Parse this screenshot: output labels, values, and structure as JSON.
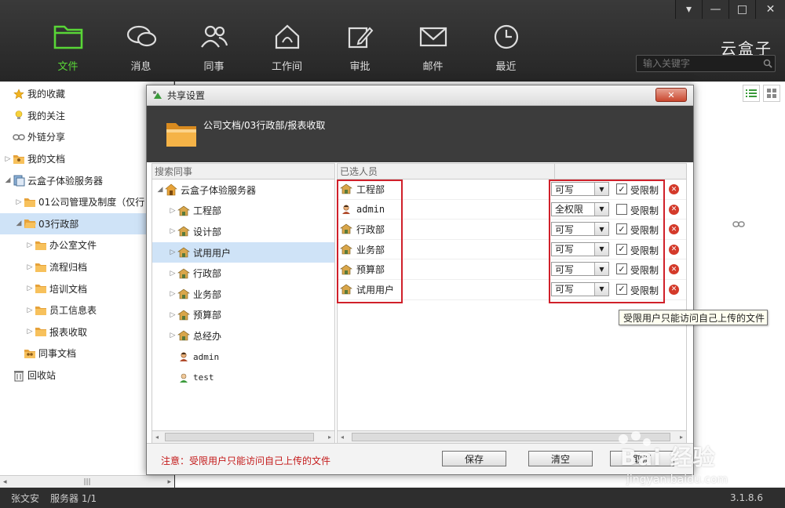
{
  "window": {
    "min": "▾",
    "restore": "—",
    "maximize": "□",
    "close": "✕"
  },
  "brand": "云盒子",
  "search": {
    "placeholder": "输入关键字"
  },
  "nav": [
    {
      "label": "文件",
      "icon": "folder-icon",
      "active": true
    },
    {
      "label": "消息",
      "icon": "chat-bubbles-icon"
    },
    {
      "label": "同事",
      "icon": "people-icon"
    },
    {
      "label": "工作间",
      "icon": "workspace-house-icon"
    },
    {
      "label": "审批",
      "icon": "edit-pen-icon"
    },
    {
      "label": "邮件",
      "icon": "mail-icon"
    },
    {
      "label": "最近",
      "icon": "clock-icon"
    }
  ],
  "left_tree": [
    {
      "label": "我的收藏",
      "icon": "star-icon",
      "indent": 1
    },
    {
      "label": "我的关注",
      "icon": "lightbulb-icon",
      "indent": 1
    },
    {
      "label": "外链分享",
      "icon": "link-icon",
      "indent": 1
    },
    {
      "label": "我的文档",
      "icon": "person-folder-icon",
      "indent": 1,
      "arrow": "▷"
    },
    {
      "label": "云盒子体验服务器",
      "icon": "server-icon",
      "indent": 1,
      "arrow": "◢"
    },
    {
      "label": "01公司管理及制度（仅行",
      "icon": "folder-icon",
      "indent": 2,
      "arrow": "▷"
    },
    {
      "label": "03行政部",
      "icon": "folder-open-icon",
      "indent": 2,
      "arrow": "◢",
      "selected": true
    },
    {
      "label": "办公室文件",
      "icon": "folder-icon",
      "indent": 3,
      "arrow": "▷"
    },
    {
      "label": "流程归档",
      "icon": "folder-icon",
      "indent": 3,
      "arrow": "▷"
    },
    {
      "label": "培训文档",
      "icon": "folder-icon",
      "indent": 3,
      "arrow": "▷"
    },
    {
      "label": "员工信息表",
      "icon": "folder-icon",
      "indent": 3,
      "arrow": "▷"
    },
    {
      "label": "报表收取",
      "icon": "folder-icon",
      "indent": 3,
      "arrow": "▷"
    },
    {
      "label": "同事文档",
      "icon": "people-folder-icon",
      "indent": 2
    },
    {
      "label": "回收站",
      "icon": "trash-icon",
      "indent": 1
    }
  ],
  "dialog": {
    "title": "共享设置",
    "close_label": "✕",
    "path": "公司文档/03行政部/报表收取",
    "search_header": "搜索同事",
    "selected_header": "已选人员",
    "colleague_tree": [
      {
        "label": "云盒子体验服务器",
        "icon": "server-house-icon",
        "indent": 0,
        "arrow": "◢"
      },
      {
        "label": "工程部",
        "icon": "department-icon",
        "indent": 1,
        "arrow": "▷"
      },
      {
        "label": "设计部",
        "icon": "department-icon",
        "indent": 1,
        "arrow": "▷"
      },
      {
        "label": "试用用户",
        "icon": "department-icon",
        "indent": 1,
        "arrow": "▷",
        "selected": true
      },
      {
        "label": "行政部",
        "icon": "department-icon",
        "indent": 1,
        "arrow": "▷"
      },
      {
        "label": "业务部",
        "icon": "department-icon",
        "indent": 1,
        "arrow": "▷"
      },
      {
        "label": "预算部",
        "icon": "department-icon",
        "indent": 1,
        "arrow": "▷"
      },
      {
        "label": "总经办",
        "icon": "department-icon",
        "indent": 1,
        "arrow": "▷"
      },
      {
        "label": "admin",
        "icon": "user-admin-icon",
        "indent": 1,
        "mono": true
      },
      {
        "label": "test",
        "icon": "user-icon",
        "indent": 1,
        "mono": true
      }
    ],
    "selected": [
      {
        "name": "工程部",
        "icon": "department-icon",
        "permission": "可写",
        "restricted": true,
        "restricted_label": "受限制"
      },
      {
        "name": "admin",
        "icon": "user-admin-icon",
        "permission": "全权限",
        "restricted": false,
        "restricted_label": "受限制",
        "mono": true
      },
      {
        "name": "行政部",
        "icon": "department-icon",
        "permission": "可写",
        "restricted": true,
        "restricted_label": "受限制"
      },
      {
        "name": "业务部",
        "icon": "department-icon",
        "permission": "可写",
        "restricted": true,
        "restricted_label": "受限制"
      },
      {
        "name": "预算部",
        "icon": "department-icon",
        "permission": "可写",
        "restricted": true,
        "restricted_label": "受限制"
      },
      {
        "name": "试用用户",
        "icon": "department-icon",
        "permission": "可写",
        "restricted": true,
        "restricted_label": "受限制"
      }
    ],
    "note": "注意：受限用户只能访问自己上传的文件",
    "buttons": {
      "save": "保存",
      "clear": "清空",
      "cancel": "取消"
    },
    "tooltip": "受限用户只能访问自己上传的文件"
  },
  "status": {
    "user": "张文安",
    "server": "服务器 1/1",
    "version": "3.1.8.6"
  },
  "watermark": {
    "line1": "Bai 经验",
    "line2": "jingyan.baidu.com"
  },
  "colors": {
    "active_nav": "#59d637",
    "highlight_box": "#d0202a",
    "note_text": "#c41a1a"
  }
}
